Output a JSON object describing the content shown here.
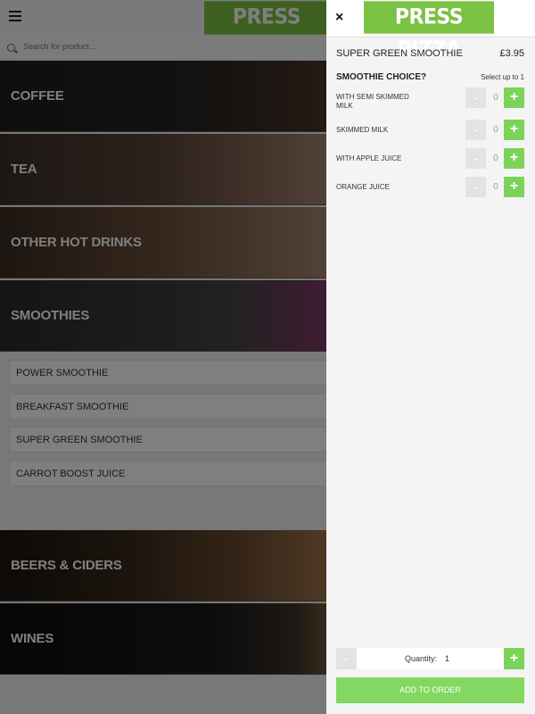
{
  "background": {
    "brand": "PRESS PIZZA",
    "search_placeholder": "Search for product...",
    "categories": [
      {
        "label": "COFFEE"
      },
      {
        "label": "TEA"
      },
      {
        "label": "OTHER HOT DRINKS"
      },
      {
        "label": "SMOOTHIES"
      },
      {
        "label": "BEERS & CIDERS"
      },
      {
        "label": "WINES"
      }
    ],
    "smoothie_products": [
      {
        "label": "POWER SMOOTHIE"
      },
      {
        "label": "BREAKFAST SMOOTHIE"
      },
      {
        "label": "SUPER GREEN SMOOTHIE"
      },
      {
        "label": "CARROT BOOST JUICE"
      }
    ]
  },
  "panel": {
    "close": "×",
    "brand": "PRESS PIZZA",
    "product_name": "SUPER GREEN SMOOTHIE",
    "price": "£3.95",
    "choice_title": "SMOOTHIE CHOICE?",
    "choice_hint": "Select up to 1",
    "options": [
      {
        "label": "WITH SEMI SKIMMED MILK",
        "count": "0"
      },
      {
        "label": "SKIMMED MILK",
        "count": "0"
      },
      {
        "label": "WITH APPLE JUICE",
        "count": "0"
      },
      {
        "label": "ORANGE JUICE",
        "count": "0"
      }
    ],
    "minus_symbol": "-",
    "plus_symbol": "+",
    "quantity_label": "Quantity:",
    "quantity_value": "1",
    "add_button": "ADD TO ORDER"
  },
  "colors": {
    "brand_green": "#7bc142",
    "plus_green": "#7cd35a",
    "add_button_green": "#82d860"
  }
}
